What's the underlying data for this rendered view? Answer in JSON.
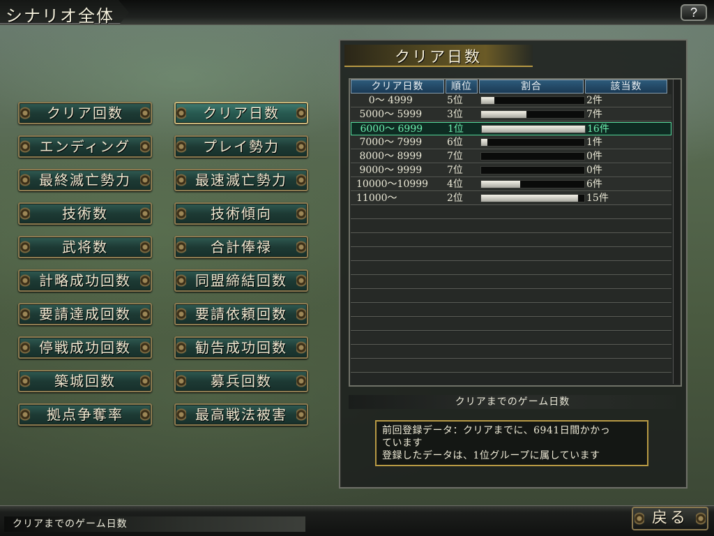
{
  "header": {
    "title": "シナリオ全体",
    "help_label": "?"
  },
  "menu": {
    "buttons": [
      "クリア回数",
      "クリア日数",
      "エンディング",
      "プレイ勢力",
      "最終滅亡勢力",
      "最速滅亡勢力",
      "技術数",
      "技術傾向",
      "武将数",
      "合計俸禄",
      "計略成功回数",
      "同盟締結回数",
      "要請達成回数",
      "要請依頼回数",
      "停戦成功回数",
      "勧告成功回数",
      "築城回数",
      "募兵回数",
      "拠点争奪率",
      "最高戦法被害"
    ],
    "active": "クリア日数"
  },
  "panel": {
    "title": "クリア日数",
    "columns": [
      "クリア日数",
      "順位",
      "割合",
      "該当数"
    ],
    "rows": [
      {
        "range": "    0～ 4999",
        "rank": "5位",
        "ratio": 0.125,
        "count": "2件"
      },
      {
        "range": " 5000～ 5999",
        "rank": "3位",
        "ratio": 0.4375,
        "count": "7件"
      },
      {
        "range": " 6000～ 6999",
        "rank": "1位",
        "ratio": 1.0,
        "count": "16件",
        "highlight": true
      },
      {
        "range": " 7000～ 7999",
        "rank": "6位",
        "ratio": 0.0625,
        "count": "1件"
      },
      {
        "range": " 8000～ 8999",
        "rank": "7位",
        "ratio": 0.0,
        "count": "0件"
      },
      {
        "range": " 9000～ 9999",
        "rank": "7位",
        "ratio": 0.0,
        "count": "0件"
      },
      {
        "range": "10000～10999",
        "rank": "4位",
        "ratio": 0.375,
        "count": "6件"
      },
      {
        "range": "11000～",
        "rank": "2位",
        "ratio": 0.9375,
        "count": "15件"
      }
    ],
    "caption": "クリアまでのゲーム日数",
    "message_lines": [
      "前回登録データ：クリアまでに、6941日間かかっ",
      "ています",
      "登録したデータは、1位グループに属しています"
    ]
  },
  "footer": {
    "status": "クリアまでのゲーム日数",
    "back_label": "戻る"
  }
}
